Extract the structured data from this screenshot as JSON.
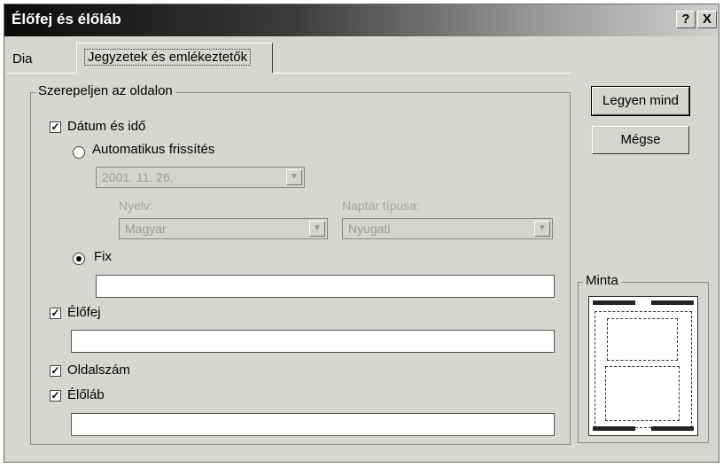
{
  "window": {
    "title": "Élőfej és élőláb",
    "help_button": "?",
    "close_button": "X"
  },
  "tabs": [
    {
      "label": "Dia"
    },
    {
      "label": "Jegyzetek és emlékeztetők"
    }
  ],
  "group": {
    "title": "Szerepeljen az oldalon",
    "date_time": {
      "label": "Dátum és idő",
      "checked": true
    },
    "auto_update": {
      "label": "Automatikus frissítés",
      "selected": false
    },
    "date_value": "2001. 11. 26.",
    "language": {
      "label": "Nyelv:",
      "value": "Magyar"
    },
    "calendar": {
      "label": "Naptár típusa:",
      "value": "Nyugati"
    },
    "fixed": {
      "label": "Fix",
      "selected": true,
      "value": ""
    },
    "header": {
      "label": "Élőfej",
      "checked": true,
      "value": ""
    },
    "page_number": {
      "label": "Oldalszám",
      "checked": true
    },
    "footer": {
      "label": "Élőláb",
      "checked": true,
      "value": ""
    }
  },
  "buttons": {
    "apply_all": "Legyen mind",
    "cancel": "Mégse"
  },
  "preview": {
    "title": "Minta"
  }
}
